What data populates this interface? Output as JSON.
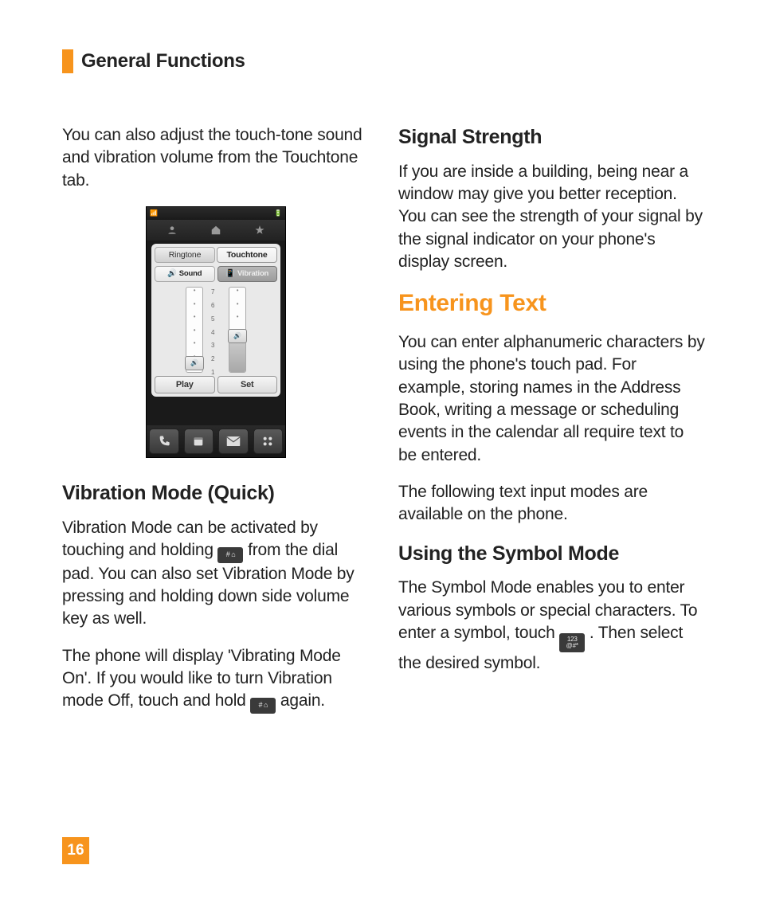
{
  "header": {
    "title": "General Functions"
  },
  "page_number": "16",
  "left": {
    "intro": "You can also adjust the touch-tone sound and vibration volume from the Touchtone tab.",
    "vibration_heading": "Vibration Mode (Quick)",
    "vibration_p1a": "Vibration Mode can be activated by touching and holding ",
    "vibration_p1b": " from the dial pad. You can also set Vibration Mode by pressing and holding down side volume key as well.",
    "vibration_p2a": "The phone will display 'Vibrating Mode On'. If you would like to turn Vibration mode Off, touch and hold ",
    "vibration_p2b": " again.",
    "hash_key_label": "# ⌂"
  },
  "right": {
    "signal_heading": "Signal Strength",
    "signal_body": "If you are inside a building, being near a window may give you better reception. You can see the strength of your signal by the signal indicator on your phone's display screen.",
    "entering_heading": "Entering Text",
    "entering_p1": "You can enter alphanumeric characters by using the phone's touch pad. For example, storing names in the Address Book, writing a message or scheduling events in the calendar all require text to be entered.",
    "entering_p2": "The following text input modes are available on the phone.",
    "symbol_heading": "Using the Symbol Mode",
    "symbol_p_a": "The Symbol Mode enables you to enter various symbols or special characters. To enter a symbol, touch ",
    "symbol_p_b": ". Then select the desired symbol.",
    "sym_key_label": "123\n@#*"
  },
  "shot": {
    "tabs": {
      "ringtone": "Ringtone",
      "touchtone": "Touchtone"
    },
    "modes": {
      "sound": "Sound",
      "vibration": "Vibration"
    },
    "scale": [
      "7",
      "6",
      "5",
      "4",
      "3",
      "2",
      "1"
    ],
    "sound_level": 1,
    "vibration_level": 3,
    "buttons": {
      "play": "Play",
      "set": "Set"
    }
  }
}
